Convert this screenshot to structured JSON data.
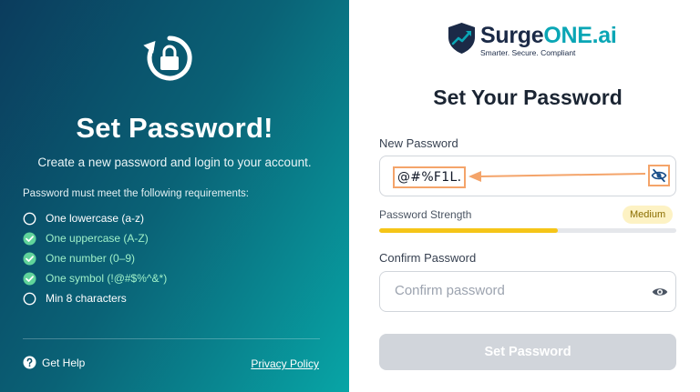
{
  "left_panel": {
    "title": "Set Password!",
    "subtitle": "Create a new password and login to your account.",
    "requirements_title": "Password must meet the following requirements:",
    "requirements": [
      {
        "label": "One lowercase (a-z)",
        "met": false
      },
      {
        "label": "One uppercase (A-Z)",
        "met": true
      },
      {
        "label": "One number (0–9)",
        "met": true
      },
      {
        "label": "One symbol (!@#$%^&*)",
        "met": true
      },
      {
        "label": "Min 8 characters",
        "met": false
      }
    ],
    "help_label": "Get Help",
    "privacy_label": "Privacy Policy"
  },
  "brand": {
    "name_part1": "Surge",
    "name_part2": "ONE.ai",
    "tagline": "Smarter. Secure. Compliant"
  },
  "form": {
    "title": "Set Your Password",
    "new_password_label": "New Password",
    "new_password_value": "@#%F1L.",
    "strength_label": "Password Strength",
    "strength_badge": "Medium",
    "strength_fraction": 0.6,
    "confirm_label": "Confirm Password",
    "confirm_placeholder": "Confirm password",
    "confirm_value": "",
    "submit_label": "Set Password"
  },
  "colors": {
    "strength_fill": "#f5c518",
    "met_check": "#5fd39a",
    "brand_accent": "#0aa6b5",
    "annotation": "#f4a46a"
  }
}
